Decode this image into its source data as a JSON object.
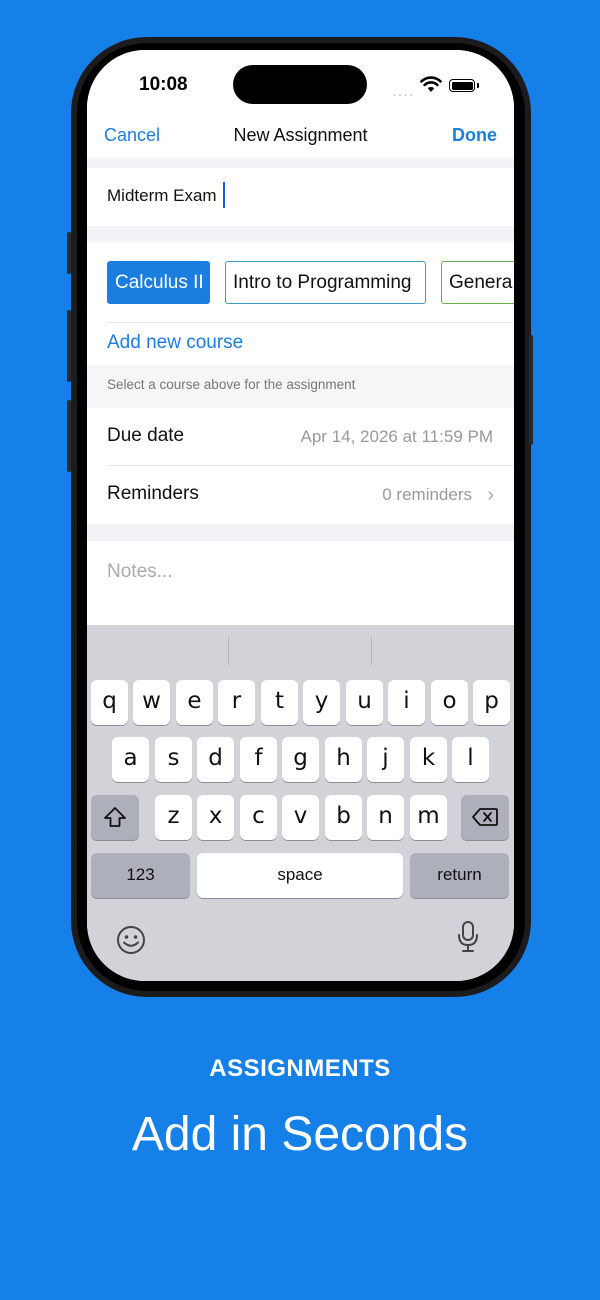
{
  "status_bar": {
    "time": "10:08",
    "signal": "····"
  },
  "nav": {
    "cancel": "Cancel",
    "title": "New Assignment",
    "done": "Done"
  },
  "form": {
    "title_value": "Midterm Exam",
    "courses": [
      "Calculus II",
      "Intro to Programming",
      "Genera"
    ],
    "selected_course": "Calculus II",
    "add_course": "Add new course",
    "course_hint": "Select a course above for the assignment",
    "due_date_label": "Due date",
    "due_date_value": "Apr 14, 2026 at 11:59 PM",
    "reminders_label": "Reminders",
    "reminders_value": "0 reminders",
    "notes_placeholder": "Notes..."
  },
  "keyboard": {
    "row1": [
      "q",
      "w",
      "e",
      "r",
      "t",
      "y",
      "u",
      "i",
      "o",
      "p"
    ],
    "row2": [
      "a",
      "s",
      "d",
      "f",
      "g",
      "h",
      "j",
      "k",
      "l"
    ],
    "row3": [
      "z",
      "x",
      "c",
      "v",
      "b",
      "n",
      "m"
    ],
    "numbers": "123",
    "space": "space",
    "return": "return"
  },
  "caption": {
    "small": "ASSIGNMENTS",
    "large": "Add in Seconds"
  },
  "colors": {
    "background": "#1580e8",
    "accent": "#1a7ee0",
    "chip_outline_blue": "#3c9cc8",
    "chip_outline_green": "#6ab04c"
  }
}
